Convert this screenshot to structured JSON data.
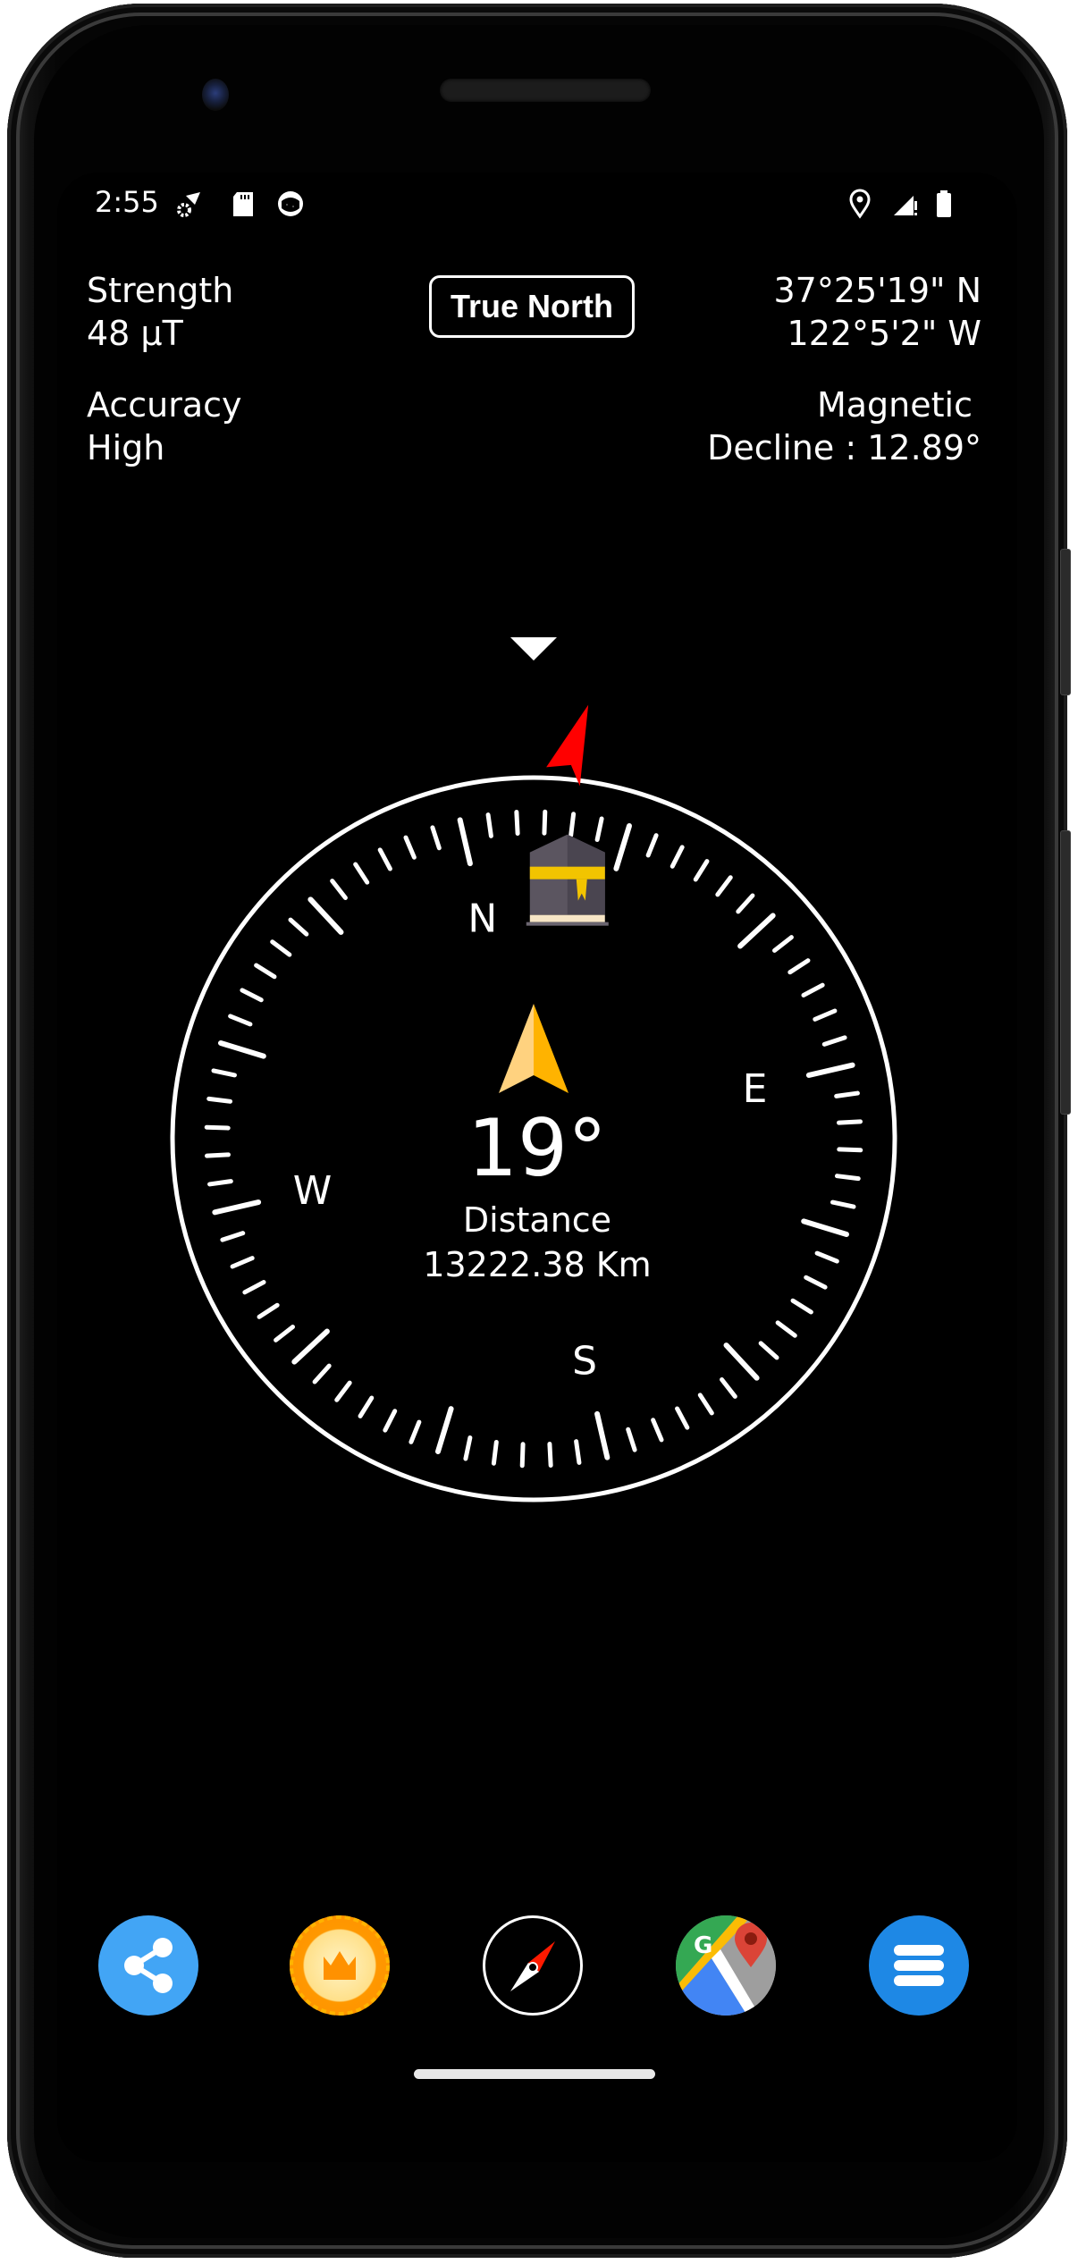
{
  "status_bar": {
    "time": "2:55",
    "left_icons": [
      "settings-wifi-icon",
      "sd-card-icon",
      "app-notification-icon"
    ],
    "right_icons": [
      "location-icon",
      "signal-alert-icon",
      "battery-icon"
    ]
  },
  "header": {
    "strength_label": "Strength",
    "strength_value": "48 µT",
    "accuracy_label": "Accuracy",
    "accuracy_value": "High",
    "mode_button": "True North",
    "latitude": "37°25'19\" N",
    "longitude": "122°5'2\" W",
    "magnetic_label": "Magnetic",
    "decline_text": "Decline : 12.89°"
  },
  "compass": {
    "cardinals": {
      "n": "N",
      "e": "E",
      "s": "S",
      "w": "W"
    },
    "heading": "19°",
    "distance_label": "Distance",
    "distance_value": "13222.38 Km",
    "dial_rotation_deg": -13,
    "qibla_bearing_deg": 19,
    "tick_count": 72,
    "major_tick_every": 6,
    "colors": {
      "arrow_light": "#FFD27F",
      "arrow_dark": "#FFB300",
      "qibla_pointer": "#FF0000"
    }
  },
  "bottom_bar": {
    "buttons": [
      {
        "name": "share",
        "icon": "share-icon",
        "color": "#42A5F5"
      },
      {
        "name": "premium",
        "icon": "crown-badge-icon",
        "color": "#FF9800"
      },
      {
        "name": "compass",
        "icon": "compass-icon",
        "color": "#000000"
      },
      {
        "name": "maps",
        "icon": "google-maps-icon",
        "color": "#34A853"
      },
      {
        "name": "menu",
        "icon": "menu-icon",
        "color": "#1E88E5"
      }
    ]
  }
}
